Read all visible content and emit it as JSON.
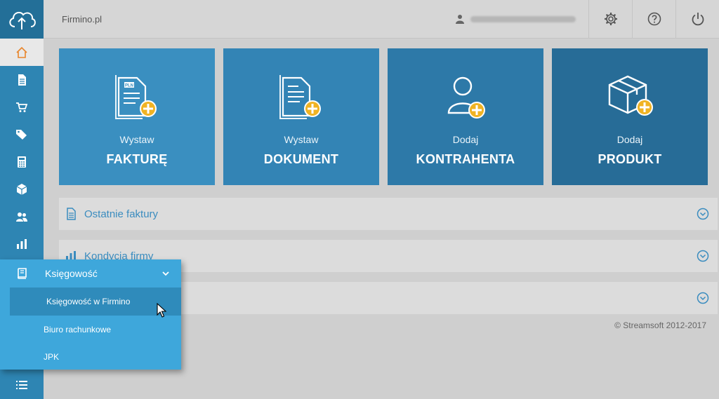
{
  "header": {
    "brand": "Firmino.pl"
  },
  "sidebar": {
    "items": [
      {
        "icon": "home-icon"
      },
      {
        "icon": "document-icon"
      },
      {
        "icon": "cart-icon"
      },
      {
        "icon": "tags-icon"
      },
      {
        "icon": "calculator-icon"
      },
      {
        "icon": "box-icon"
      },
      {
        "icon": "users-icon"
      },
      {
        "icon": "bar-chart-icon"
      },
      {
        "icon": "book-icon"
      },
      {
        "icon": "list-icon"
      }
    ]
  },
  "tiles": [
    {
      "small": "Wystaw",
      "big": "FAKTURĘ",
      "color": "#3a8fc0",
      "icon_label": "PLN"
    },
    {
      "small": "Wystaw",
      "big": "DOKUMENT",
      "color": "#3384b5"
    },
    {
      "small": "Dodaj",
      "big": "KONTRAHENTA",
      "color": "#2d79a8"
    },
    {
      "small": "Dodaj",
      "big": "PRODUKT",
      "color": "#276c97"
    }
  ],
  "panels": [
    {
      "title": "Ostatnie faktury"
    },
    {
      "title": "Kondycja firmy"
    },
    {
      "title": ""
    }
  ],
  "footer": "© Streamsoft 2012-2017",
  "flyout": {
    "title": "Księgowość",
    "items": [
      "Księgowość w Firmino",
      "Biuro rachunkowe",
      "JPK"
    ]
  },
  "colors": {
    "accent": "#3a8cbf",
    "sidebar": "#2e85b3",
    "plus": "#f0b323",
    "home": "#e8852b"
  }
}
